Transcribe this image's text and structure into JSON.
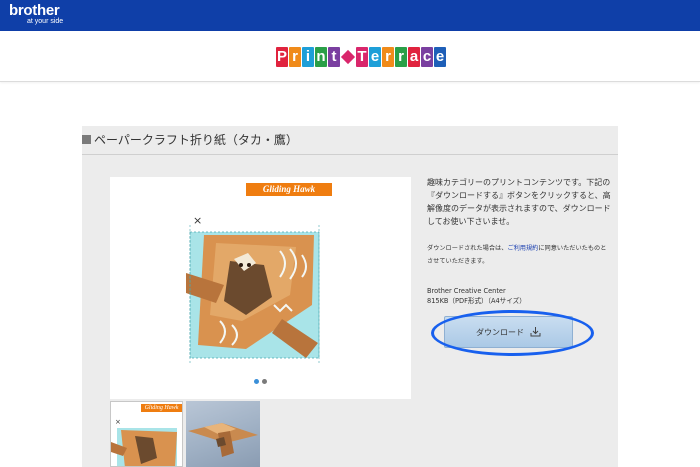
{
  "header": {
    "brand": "brother",
    "tagline": "at your side",
    "bar_color": "#0f3fa8"
  },
  "logo": {
    "word1": [
      "P",
      "r",
      "i",
      "n",
      "t"
    ],
    "word1_colors": [
      "#e0233e",
      "#f08b1a",
      "#1e9fd8",
      "#2a9f48",
      "#7a3fa0"
    ],
    "word2": [
      "T",
      "e",
      "r",
      "r",
      "a",
      "c",
      "e"
    ],
    "word2_colors": [
      "#d9266b",
      "#1e9fd8",
      "#f08b1a",
      "#2a9f48",
      "#e0233e",
      "#7a3fa0",
      "#1e5fb8"
    ]
  },
  "panel": {
    "title": "ペーパークラフト折り紙（タカ・鷹）"
  },
  "gallery": {
    "banner": "Gliding Hawk",
    "thumb_banner": "Gliding Hawk",
    "x_mark": "×",
    "dots": [
      "active",
      "inactive"
    ],
    "dot_colors": {
      "active": "#3a8fd8",
      "inactive": "#7a7a7a"
    }
  },
  "info": {
    "description": "趣味カテゴリーのプリントコンテンツです。下記の『ダウンロードする』ボタンをクリックすると、高解像度のデータが表示されますので、ダウンロードしてお使い下さいませ。",
    "note_prefix": "ダウンロードされた場合は、",
    "note_link": "ご利用規約",
    "note_suffix": "に同意いただいたものとさせていただきます。",
    "file_source": "Brother Creative Center",
    "file_meta": "815KB（PDF形式）（A4サイズ）"
  },
  "download": {
    "label": "ダウンロード",
    "icon": "download-icon",
    "highlight_color": "#1860ee"
  }
}
